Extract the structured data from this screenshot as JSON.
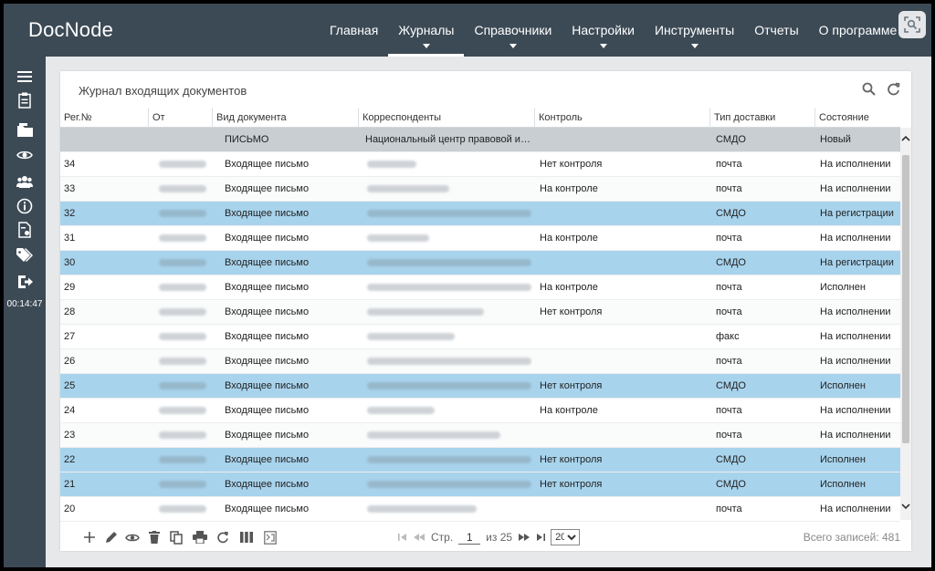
{
  "app": {
    "title": "DocNode"
  },
  "nav": [
    {
      "label": "Главная",
      "active": false,
      "dropdown": false
    },
    {
      "label": "Журналы",
      "active": true,
      "dropdown": true
    },
    {
      "label": "Справочники",
      "active": false,
      "dropdown": true
    },
    {
      "label": "Настройки",
      "active": false,
      "dropdown": true
    },
    {
      "label": "Инструменты",
      "active": false,
      "dropdown": true
    },
    {
      "label": "Отчеты",
      "active": false,
      "dropdown": false
    },
    {
      "label": "О программе",
      "active": false,
      "dropdown": false
    }
  ],
  "corner_icon": "scan-icon",
  "sidebar": {
    "icons": [
      "menu-icon",
      "clipboard-icon",
      "folder-icon",
      "eye-icon",
      "users-icon",
      "info-icon",
      "document-settings-icon",
      "tags-icon",
      "logout-icon"
    ],
    "timer": "00:14:47"
  },
  "journal": {
    "title": "Журнал входящих документов",
    "tools": [
      "search-icon",
      "refresh-icon"
    ]
  },
  "columns": [
    "Рег.№",
    "От",
    "Вид документа",
    "Корреспонденты",
    "Контроль",
    "Тип доставки",
    "Состояние"
  ],
  "rows": [
    {
      "type": "group",
      "reg": "",
      "from": "",
      "kind": "ПИСЬМО",
      "corr": "Национальный центр правовой ин...",
      "control": "",
      "delivery": "СМДО",
      "state": "Новый"
    },
    {
      "type": "normal",
      "reg": "34",
      "from": "",
      "kind": "Входящее письмо",
      "corr": "",
      "control": "Нет контроля",
      "delivery": "почта",
      "state": "На исполнении"
    },
    {
      "type": "alt",
      "reg": "33",
      "from": "",
      "kind": "Входящее письмо",
      "corr": "",
      "control": "На контроле",
      "delivery": "почта",
      "state": "На исполнении"
    },
    {
      "type": "sel",
      "reg": "32",
      "from": "",
      "kind": "Входящее письмо",
      "corr": "",
      "control": "",
      "delivery": "СМДО",
      "state": "На регистрации"
    },
    {
      "type": "normal",
      "reg": "31",
      "from": "",
      "kind": "Входящее письмо",
      "corr": "",
      "control": "На контроле",
      "delivery": "почта",
      "state": "На исполнении"
    },
    {
      "type": "sel",
      "reg": "30",
      "from": "",
      "kind": "Входящее письмо",
      "corr": "",
      "control": "",
      "delivery": "СМДО",
      "state": "На регистрации"
    },
    {
      "type": "normal",
      "reg": "29",
      "from": "",
      "kind": "Входящее письмо",
      "corr": "",
      "control": "На контроле",
      "delivery": "почта",
      "state": "Исполнен"
    },
    {
      "type": "alt",
      "reg": "28",
      "from": "",
      "kind": "Входящее письмо",
      "corr": "",
      "control": "Нет контроля",
      "delivery": "почта",
      "state": "На исполнении"
    },
    {
      "type": "normal",
      "reg": "27",
      "from": "",
      "kind": "Входящее письмо",
      "corr": "",
      "control": "",
      "delivery": "факс",
      "state": "На исполнении"
    },
    {
      "type": "alt",
      "reg": "26",
      "from": "",
      "kind": "Входящее письмо",
      "corr": "",
      "control": "",
      "delivery": "почта",
      "state": "На исполнении"
    },
    {
      "type": "sel",
      "reg": "25",
      "from": "",
      "kind": "Входящее письмо",
      "corr": "",
      "control": "Нет контроля",
      "delivery": "СМДО",
      "state": "Исполнен"
    },
    {
      "type": "normal",
      "reg": "24",
      "from": "",
      "kind": "Входящее письмо",
      "corr": "",
      "control": "На контроле",
      "delivery": "почта",
      "state": "На исполнении"
    },
    {
      "type": "alt",
      "reg": "23",
      "from": "",
      "kind": "Входящее письмо",
      "corr": "",
      "control": "",
      "delivery": "почта",
      "state": "На исполнении"
    },
    {
      "type": "sel",
      "reg": "22",
      "from": "",
      "kind": "Входящее письмо",
      "corr": "",
      "control": "Нет контроля",
      "delivery": "СМДО",
      "state": "Исполнен"
    },
    {
      "type": "sel",
      "reg": "21",
      "from": "",
      "kind": "Входящее письмо",
      "corr": "",
      "control": "Нет контроля",
      "delivery": "СМДО",
      "state": "Исполнен"
    },
    {
      "type": "normal",
      "reg": "20",
      "from": "",
      "kind": "Входящее письмо",
      "corr": "",
      "control": "",
      "delivery": "почта",
      "state": "На исполнении"
    }
  ],
  "footer": {
    "tools": [
      "add-icon",
      "edit-icon",
      "view-icon",
      "delete-icon",
      "copy-icon",
      "print-icon",
      "refresh-icon",
      "columns-icon",
      "export-icon"
    ],
    "pager": {
      "page_label": "Стр.",
      "page": "1",
      "of_label": "из 25",
      "page_size": "20"
    },
    "total": "Всего записей: 481"
  },
  "colors": {
    "bar": "#3c4a55",
    "selected": "#a8d3ec",
    "group": "#c8ced2",
    "background": "#e6e8ea"
  }
}
